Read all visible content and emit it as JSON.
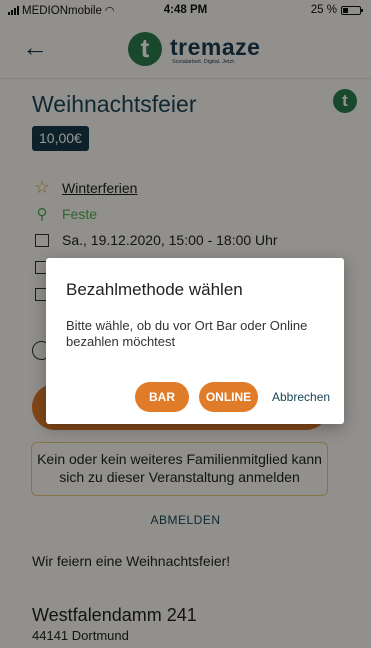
{
  "status_bar": {
    "carrier": "MEDIONmobile",
    "time": "4:48 PM",
    "battery": "25 %",
    "battery_level": 0.25
  },
  "header": {
    "logo_letter": "t",
    "logo_text": "tremaze",
    "logo_tagline": "Sozialarbeit. Digital. Jetzt."
  },
  "event": {
    "title": "Weihnachtsfeier",
    "title_icon_letter": "t",
    "price": "10,00€",
    "category": "Winterferien",
    "tag": "Feste",
    "datetime": "Sa., 19.12.2020, 15:00 - 18:00 Uhr",
    "notice": "Kein oder kein weiteres Familienmitglied kann sich zu dieser Veranstaltung anmelden",
    "unregister": "ABMELDEN",
    "description": "Wir feiern eine Weihnachtsfeier!",
    "address_street": "Westfalendamm 241",
    "address_city": "44141 Dortmund"
  },
  "dialog": {
    "title": "Bezahlmethode wählen",
    "message": "Bitte wähle, ob du vor Ort Bar oder Online bezahlen möchtest",
    "btn_bar": "BAR",
    "btn_online": "ONLINE",
    "btn_cancel": "Abbrechen"
  },
  "colors": {
    "accent_orange": "#e07b2a",
    "brand_green": "#2e7d4c",
    "navy": "#1b3b4e"
  }
}
